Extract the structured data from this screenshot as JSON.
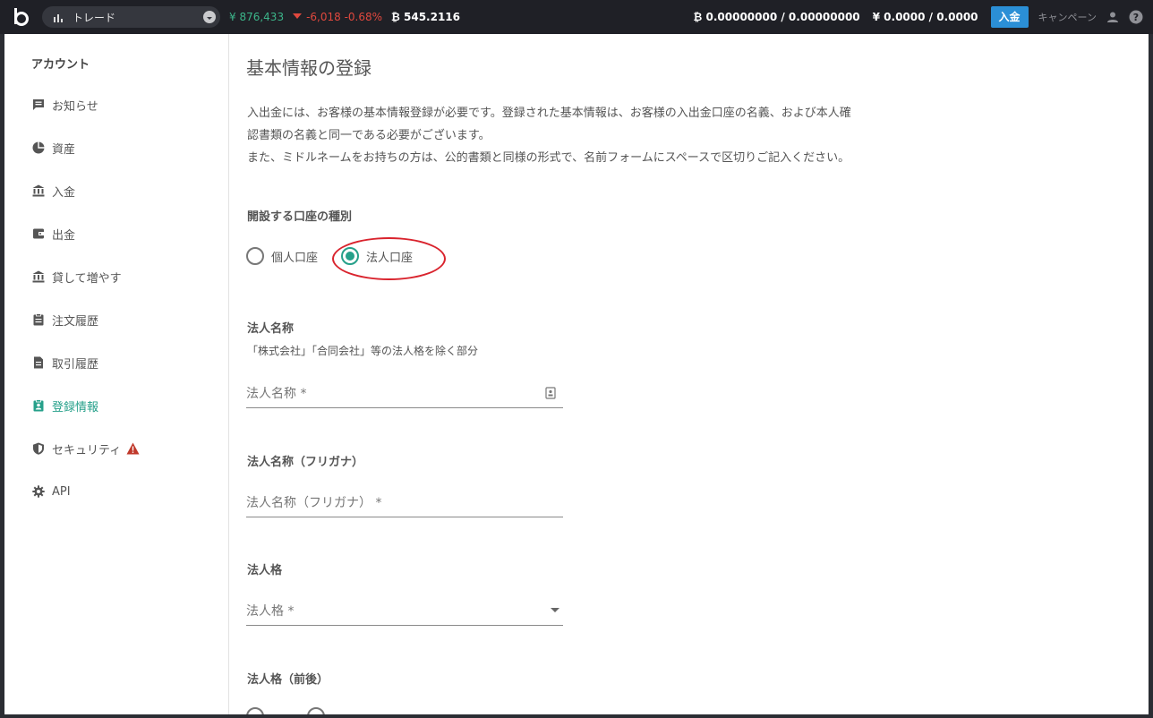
{
  "topbar": {
    "market_label": "トレード",
    "jpy_price": "¥ 876,433",
    "change": "-6,018 -0.68%",
    "btc_amount": "₿ 545.2116",
    "btc_balance": "₿ 0.00000000 / 0.00000000",
    "jpy_balance": "¥ 0.0000 / 0.0000",
    "deposit_label": "入金",
    "campaign_label": "キャンペーン"
  },
  "sidebar": {
    "title": "アカウント",
    "items": [
      {
        "label": "お知らせ",
        "icon": "message-icon"
      },
      {
        "label": "資産",
        "icon": "pie-chart-icon"
      },
      {
        "label": "入金",
        "icon": "bank-icon"
      },
      {
        "label": "出金",
        "icon": "wallet-icon"
      },
      {
        "label": "貸して増やす",
        "icon": "bank-icon"
      },
      {
        "label": "注文履歴",
        "icon": "clipboard-icon"
      },
      {
        "label": "取引履歴",
        "icon": "document-icon"
      },
      {
        "label": "登録情報",
        "icon": "id-card-icon"
      },
      {
        "label": "セキュリティ",
        "icon": "shield-icon"
      },
      {
        "label": "API",
        "icon": "gear-icon"
      }
    ],
    "active_item": "登録情報"
  },
  "main": {
    "title": "基本情報の登録",
    "intro_line1": "入出金には、お客様の基本情報登録が必要です。登録された基本情報は、お客様の入出金口座の名義、および本人確",
    "intro_line2": "認書類の名義と同一である必要がございます。",
    "intro_line3": "また、ミドルネームをお持ちの方は、公的書類と同様の形式で、名前フォームにスペースで区切りご記入ください。",
    "account_type_label": "開設する口座の種別",
    "account_type_options": [
      "個人口座",
      "法人口座"
    ],
    "account_type_selected": "法人口座",
    "corp_name_label": "法人名称",
    "corp_name_hint": "「株式会社」「合同会社」等の法人格を除く部分",
    "corp_name_placeholder": "法人名称 *",
    "corp_kana_label": "法人名称（フリガナ）",
    "corp_kana_placeholder": "法人名称（フリガナ） *",
    "corp_type_label": "法人格",
    "corp_type_placeholder": "法人格 *",
    "corp_position_label": "法人格（前後）"
  },
  "colors": {
    "accent": "#26a08a",
    "topbar_bg": "#1f2026",
    "deposit_button": "#2b8fd6",
    "price_up": "#3cb489",
    "price_down": "#e0483e",
    "highlight": "#d9232d"
  }
}
